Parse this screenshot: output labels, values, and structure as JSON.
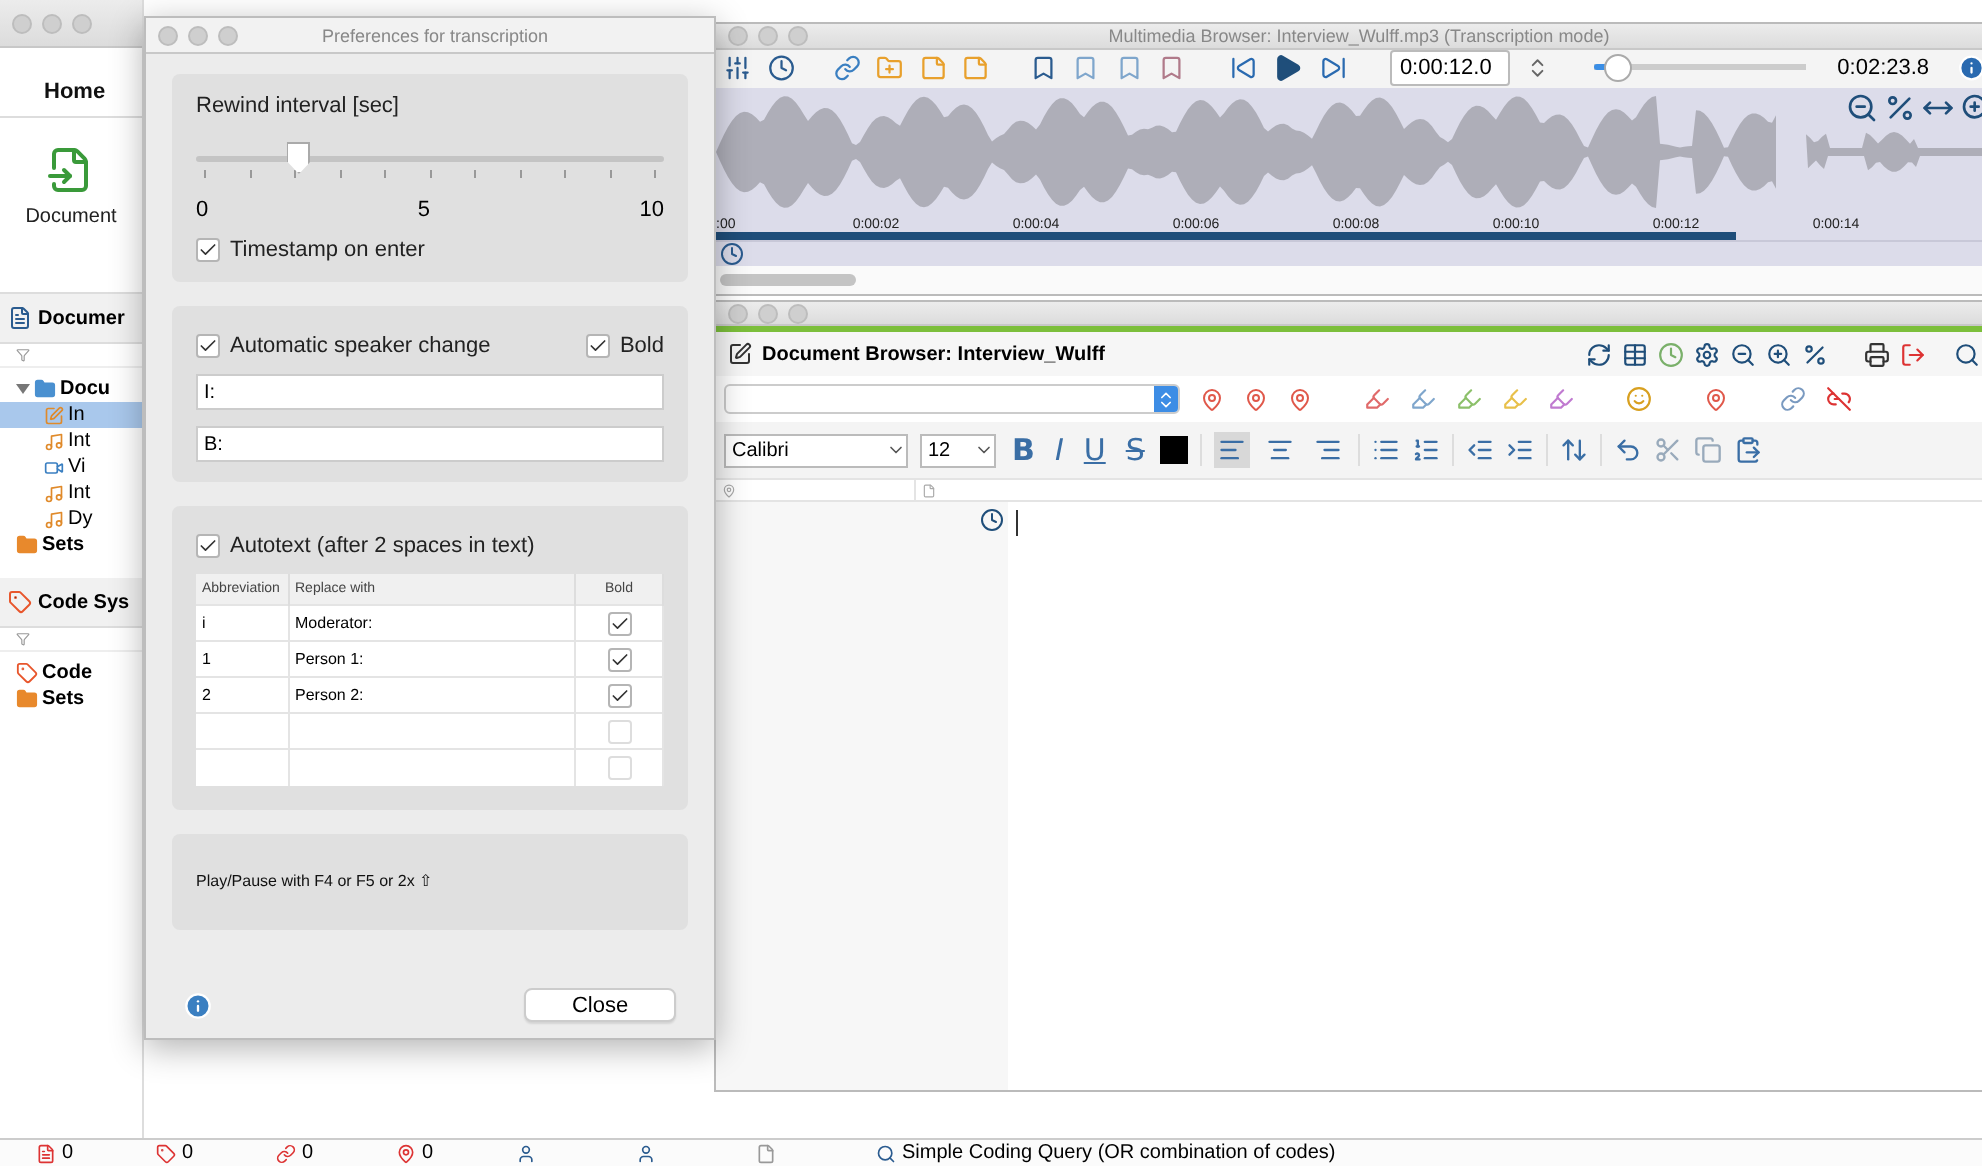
{
  "main_window": {
    "tabs": [
      {
        "label": "Home",
        "selected": true
      }
    ],
    "ribbon_button": "Document",
    "document_panel": {
      "title": "Documer",
      "tree": [
        {
          "label": "Docu",
          "expanded": true,
          "selected": false,
          "children": [
            {
              "label": "In",
              "selected": true
            },
            {
              "label": "Int",
              "selected": false
            },
            {
              "label": "Vi",
              "selected": false
            },
            {
              "label": "Int",
              "selected": false
            },
            {
              "label": "Dy",
              "selected": false
            }
          ]
        },
        {
          "label": "Sets",
          "selected": false
        }
      ]
    },
    "code_panel": {
      "title": "Code Sys",
      "tree": [
        {
          "label": "Code",
          "selected": false
        },
        {
          "label": "Sets",
          "selected": false
        }
      ]
    },
    "status_bar": {
      "counters": [
        "0",
        "0",
        "0",
        "0"
      ],
      "query": "Simple Coding Query (OR combination of codes)"
    }
  },
  "multimedia_browser": {
    "title": "Multimedia Browser:  Interview_Wulff.mp3 (Transcription mode)",
    "position": "0:00:12.0",
    "volume": {
      "level": 0.12
    },
    "duration": "0:02:23.8",
    "playhead": {
      "level": 0.8
    },
    "timeline_ticks": [
      ":00",
      "0:00:02",
      "0:00:04",
      "0:00:06",
      "0:00:08",
      "0:00:10",
      "0:00:12",
      "0:00:14"
    ]
  },
  "document_browser": {
    "title": "Document Browser: Interview_Wulff",
    "font": "Calibri",
    "size": "12",
    "format_buttons": [
      {
        "label": "B",
        "kind": "bold"
      },
      {
        "label": "I",
        "kind": "italic"
      },
      {
        "label": "U",
        "kind": "underline"
      },
      {
        "label": "S",
        "kind": "strike"
      }
    ],
    "alignment": [
      {
        "selected": true
      },
      {
        "selected": false
      },
      {
        "selected": false
      }
    ]
  },
  "preferences": {
    "title": "Preferences for transcription",
    "rewind": {
      "label": "Rewind interval [sec]",
      "level": 0.22,
      "scale": [
        "0",
        "5",
        "10"
      ]
    },
    "timestamp_on_enter": {
      "label": "Timestamp on enter",
      "checked": true
    },
    "speaker_change": {
      "label": "Automatic speaker change",
      "checked": true,
      "bold": {
        "label": "Bold",
        "checked": true
      },
      "fields": [
        "I:",
        "B:"
      ]
    },
    "autotext": {
      "label": "Autotext (after 2 spaces in text)",
      "checked": true,
      "columns": [
        "Abbreviation",
        "Replace with",
        "Bold"
      ],
      "rows": [
        {
          "abbreviation": "i",
          "replacement": "Moderator:",
          "bold": true
        },
        {
          "abbreviation": "1",
          "replacement": "Person 1:",
          "bold": true
        },
        {
          "abbreviation": "2",
          "replacement": "Person 2:",
          "bold": true
        },
        {
          "bold": false
        },
        {
          "bold": false
        }
      ]
    },
    "hint": "Play/Pause with F4 or F5 or 2x ⇧",
    "close": "Close"
  }
}
